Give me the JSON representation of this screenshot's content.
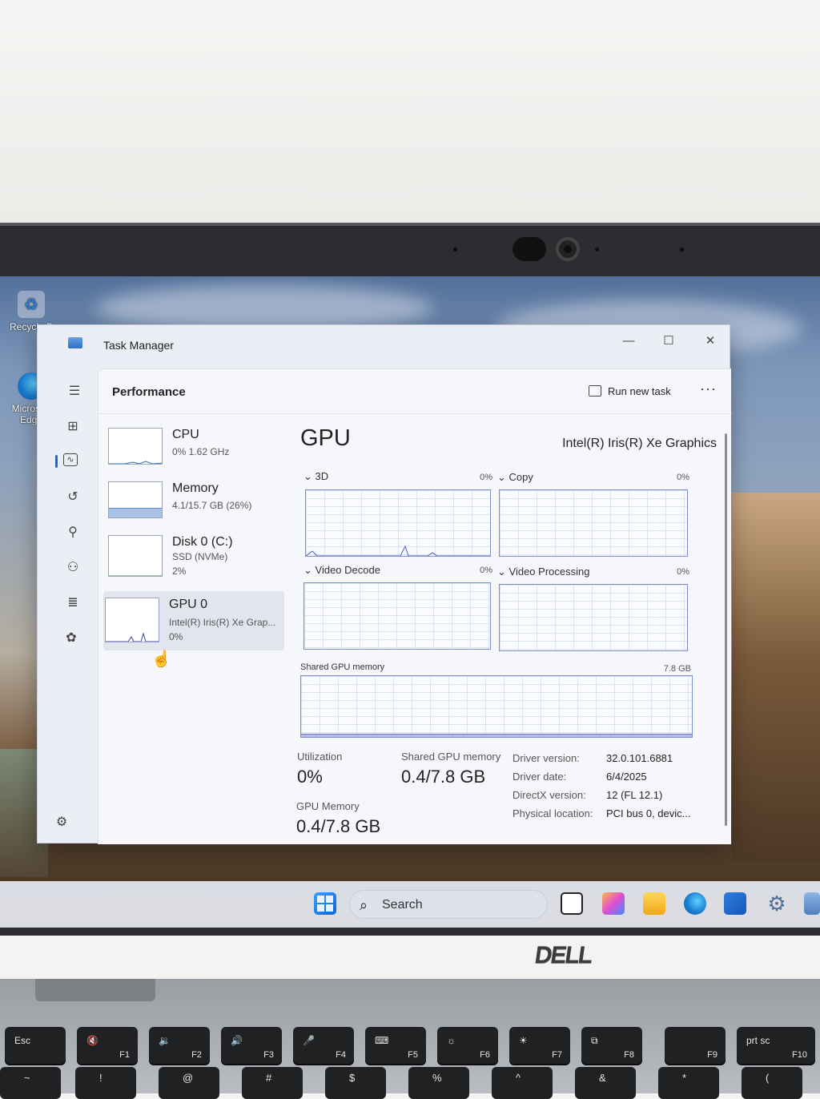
{
  "desktop": {
    "icons": [
      {
        "label": "Recycle B",
        "icon": "recycle-bin-icon"
      },
      {
        "label": "Microsoft Edge",
        "icon": "edge-icon"
      }
    ]
  },
  "window": {
    "title": "Task Manager",
    "controls": {
      "minimize": "—",
      "maximize": "☐",
      "close": "✕"
    }
  },
  "page": {
    "name": "Performance",
    "run_task_label": "Run new task",
    "more_label": "···"
  },
  "nav_icons": [
    "hamburger-icon",
    "processes-icon",
    "performance-icon",
    "app-history-icon",
    "startup-icon",
    "users-icon",
    "details-icon",
    "services-icon",
    "settings-icon"
  ],
  "devices": [
    {
      "name": "CPU",
      "line1": "0%  1.62 GHz",
      "line2": ""
    },
    {
      "name": "Memory",
      "line1": "4.1/15.7 GB (26%)",
      "line2": ""
    },
    {
      "name": "Disk 0 (C:)",
      "line1": "SSD (NVMe)",
      "line2": "2%"
    },
    {
      "name": "GPU 0",
      "line1": "Intel(R) Iris(R) Xe Grap...",
      "line2": "0%"
    }
  ],
  "gpu": {
    "title": "GPU",
    "adapter": "Intel(R) Iris(R) Xe Graphics",
    "engines": [
      {
        "label": "3D",
        "pct": "0%"
      },
      {
        "label": "Copy",
        "pct": "0%"
      },
      {
        "label": "Video Decode",
        "pct": "0%"
      },
      {
        "label": "Video Processing",
        "pct": "0%"
      }
    ],
    "shared_mem_label": "Shared GPU memory",
    "shared_mem_max": "7.8 GB",
    "stats": {
      "utilization_label": "Utilization",
      "utilization_value": "0%",
      "shared_label": "Shared GPU memory",
      "shared_value": "0.4/7.8 GB",
      "gpumem_label": "GPU Memory",
      "gpumem_value": "0.4/7.8 GB"
    },
    "details": [
      {
        "key": "Driver version:",
        "value": "32.0.101.6881"
      },
      {
        "key": "Driver date:",
        "value": "6/4/2025"
      },
      {
        "key": "DirectX version:",
        "value": "12 (FL 12.1)"
      },
      {
        "key": "Physical location:",
        "value": "PCI bus 0, devic..."
      }
    ]
  },
  "taskbar": {
    "search_placeholder": "Search"
  },
  "laptop": {
    "brand": "DELL",
    "fn_keys": [
      {
        "top": "Esc",
        "bottom": ""
      },
      {
        "top": "🔇",
        "bottom": "F1"
      },
      {
        "top": "🔉",
        "bottom": "F2"
      },
      {
        "top": "🔊",
        "bottom": "F3"
      },
      {
        "top": "🎤",
        "bottom": "F4"
      },
      {
        "top": "⌨",
        "bottom": "F5"
      },
      {
        "top": "☼",
        "bottom": "F6"
      },
      {
        "top": "☀",
        "bottom": "F7"
      },
      {
        "top": "⧉",
        "bottom": "F8"
      },
      {
        "top": "",
        "bottom": "F9"
      },
      {
        "top": "prt sc",
        "bottom": "F10"
      }
    ],
    "num_keys": [
      "~",
      "!",
      "@",
      "#",
      "$",
      "%",
      "^",
      "&",
      "*",
      "("
    ]
  }
}
